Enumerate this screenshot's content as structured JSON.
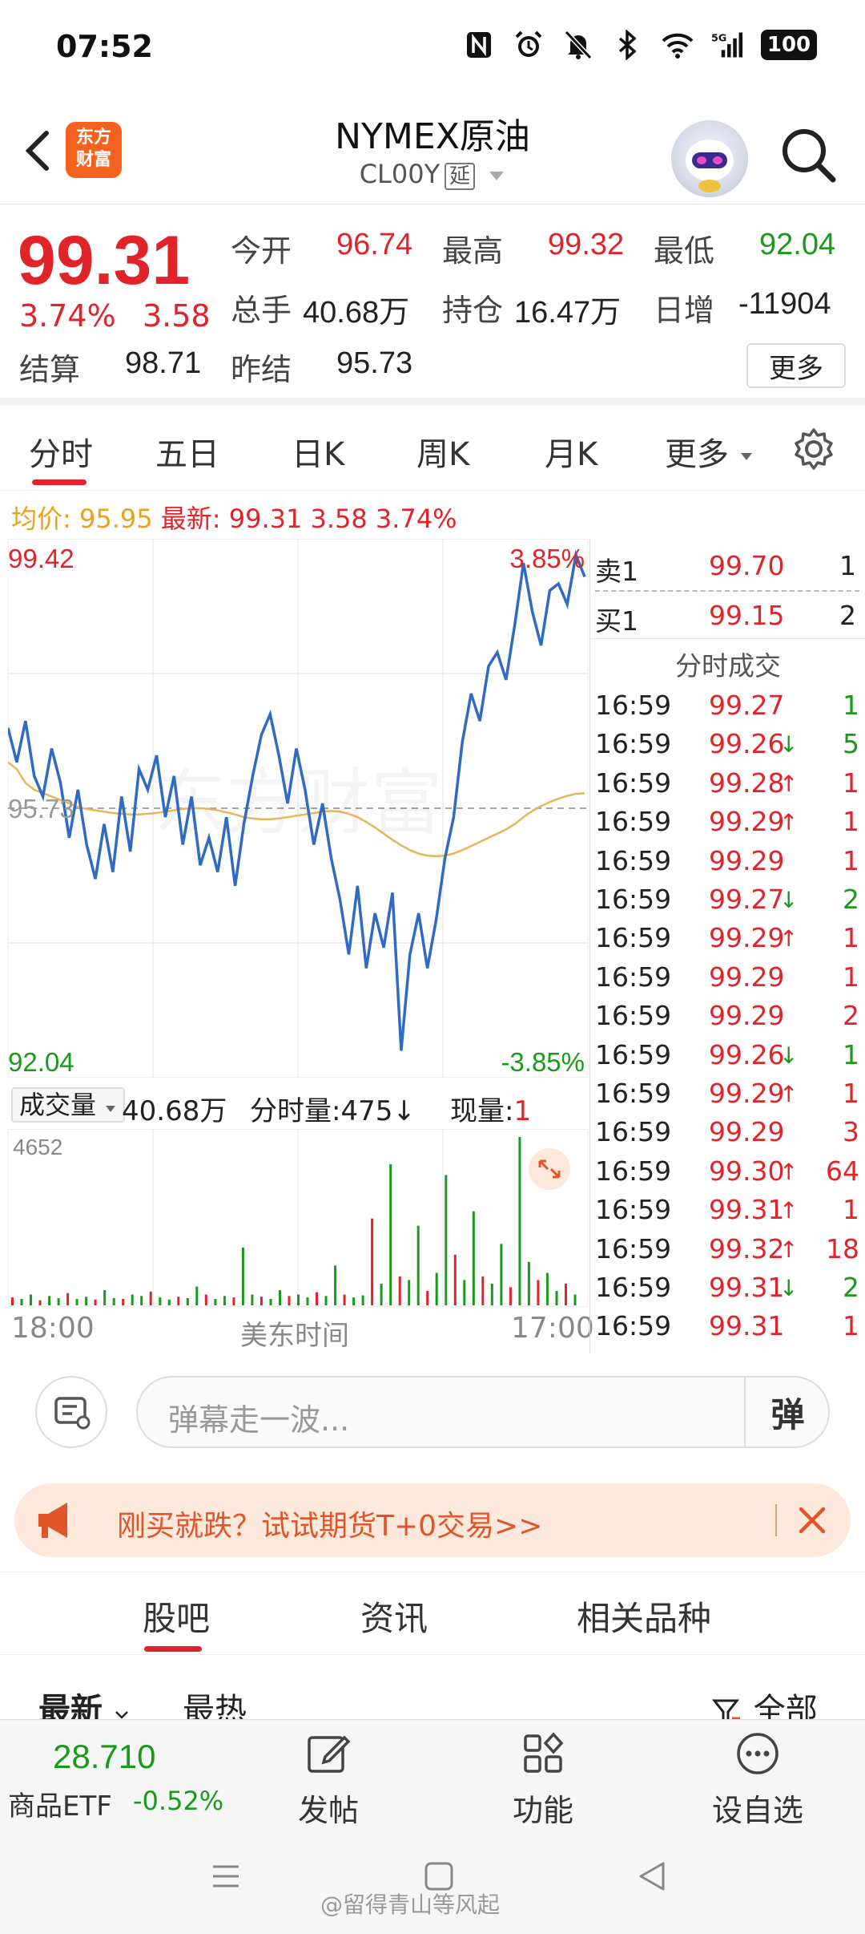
{
  "status_bar": {
    "time": "07:52",
    "battery": "100",
    "icons": [
      "nfc-icon",
      "alarm-icon",
      "mute-icon",
      "bluetooth-icon",
      "wifi-icon",
      "signal-5g-icon",
      "battery-icon"
    ]
  },
  "header": {
    "title": "NYMEX原油",
    "code": "CL00Y",
    "delay_badge": "延",
    "logo_line1": "东方",
    "logo_line2": "财富"
  },
  "quote": {
    "last": "99.31",
    "change_pct": "3.74%",
    "change": "3.58",
    "open_label": "今开",
    "open": "96.74",
    "high_label": "最高",
    "high": "99.32",
    "low_label": "最低",
    "low": "92.04",
    "volume_label": "总手",
    "volume": "40.68万",
    "oi_label": "持仓",
    "oi": "16.47万",
    "daily_inc_label": "日增",
    "daily_inc": "-11904",
    "settle_label": "结算",
    "settle": "98.71",
    "prev_settle_label": "昨结",
    "prev_settle": "95.73",
    "more": "更多"
  },
  "tabs": {
    "items": [
      "分时",
      "五日",
      "日K",
      "周K",
      "月K",
      "更多"
    ],
    "active": 0
  },
  "avg_info": {
    "avg_label": "均价:",
    "avg": "95.95",
    "latest_label": "最新:",
    "latest": "99.31",
    "change": "3.58",
    "change_pct": "3.74%"
  },
  "chart_data": {
    "type": "line",
    "series": [
      {
        "values": [
          96.9,
          96.4,
          97.0,
          96.2,
          95.9,
          96.6,
          96.1,
          95.3,
          96.0,
          95.2,
          94.7,
          95.5,
          94.8,
          95.9,
          95.1,
          96.3,
          96.0,
          96.5,
          95.6,
          96.2,
          95.2,
          95.9,
          94.9,
          95.3,
          94.8,
          95.6,
          94.6,
          95.5,
          96.2,
          96.8,
          97.1,
          96.5,
          95.8,
          96.6,
          96.0,
          95.2,
          95.8,
          95.0,
          94.4,
          93.6,
          94.6,
          93.4,
          94.2,
          93.7,
          94.5,
          92.2,
          93.6,
          94.2,
          93.4,
          94.1,
          95.0,
          95.6,
          96.7,
          97.4,
          97.0,
          97.8,
          98.0,
          97.6,
          98.4,
          99.3,
          98.6,
          98.1,
          98.9,
          99.0,
          98.7,
          99.42,
          99.1
        ]
      },
      {
        "values": [
          96.4,
          96.3,
          96.1,
          96.0,
          95.95,
          95.9,
          95.85,
          95.8,
          95.75,
          95.72,
          95.7,
          95.68,
          95.66,
          95.65,
          95.64,
          95.64,
          95.65,
          95.66,
          95.68,
          95.7,
          95.72,
          95.73,
          95.73,
          95.72,
          95.7,
          95.67,
          95.64,
          95.6,
          95.58,
          95.57,
          95.57,
          95.58,
          95.6,
          95.62,
          95.64,
          95.66,
          95.68,
          95.69,
          95.68,
          95.65,
          95.6,
          95.53,
          95.45,
          95.36,
          95.27,
          95.19,
          95.12,
          95.07,
          95.04,
          95.03,
          95.04,
          95.07,
          95.12,
          95.18,
          95.24,
          95.3,
          95.36,
          95.42,
          95.5,
          95.6,
          95.69,
          95.76,
          95.82,
          95.87,
          95.91,
          95.94,
          95.95
        ]
      }
    ],
    "ylim": [
      92.04,
      99.42
    ],
    "y_ticks_left": [
      "99.42",
      "95.73",
      "92.04"
    ],
    "y_ticks_right": [
      "3.85%",
      "-3.85%"
    ],
    "ref_price": 95.73,
    "x_start": "18:00",
    "x_mid": "美东时间",
    "x_end": "17:00",
    "grid": true
  },
  "volume": {
    "label": "成交量",
    "total": "40.68万",
    "tick_label": "分时量:475↓",
    "current_label": "现量:",
    "current": "1",
    "max_tick": "4652",
    "bars": [
      220,
      180,
      300,
      140,
      260,
      200,
      340,
      180,
      240,
      160,
      420,
      200,
      180,
      300,
      260,
      380,
      220,
      160,
      240,
      200,
      520,
      300,
      180,
      260,
      220,
      1600,
      300,
      240,
      180,
      420,
      260,
      300,
      220,
      360,
      260,
      1100,
      300,
      220,
      280,
      2400,
      600,
      3900,
      800,
      700,
      2200,
      400,
      900,
      3600,
      1400,
      700,
      2600,
      800,
      600,
      1700,
      500,
      4652,
      1200,
      700,
      900,
      400,
      600,
      300
    ]
  },
  "order_book": {
    "ask_label": "卖1",
    "ask_price": "99.70",
    "ask_vol": "1",
    "bid_label": "买1",
    "bid_price": "99.15",
    "bid_vol": "2",
    "trades_title": "分时成交",
    "trades": [
      {
        "time": "16:59",
        "price": "99.27",
        "arrow": "",
        "vol": "1",
        "vol_color": "green"
      },
      {
        "time": "16:59",
        "price": "99.26",
        "arrow": "↓",
        "vol": "5",
        "vol_color": "green"
      },
      {
        "time": "16:59",
        "price": "99.28",
        "arrow": "↑",
        "vol": "1",
        "vol_color": "red"
      },
      {
        "time": "16:59",
        "price": "99.29",
        "arrow": "↑",
        "vol": "1",
        "vol_color": "red"
      },
      {
        "time": "16:59",
        "price": "99.29",
        "arrow": "",
        "vol": "1",
        "vol_color": "red"
      },
      {
        "time": "16:59",
        "price": "99.27",
        "arrow": "↓",
        "vol": "2",
        "vol_color": "green"
      },
      {
        "time": "16:59",
        "price": "99.29",
        "arrow": "↑",
        "vol": "1",
        "vol_color": "red"
      },
      {
        "time": "16:59",
        "price": "99.29",
        "arrow": "",
        "vol": "1",
        "vol_color": "red"
      },
      {
        "time": "16:59",
        "price": "99.29",
        "arrow": "",
        "vol": "2",
        "vol_color": "red"
      },
      {
        "time": "16:59",
        "price": "99.26",
        "arrow": "↓",
        "vol": "1",
        "vol_color": "green"
      },
      {
        "time": "16:59",
        "price": "99.29",
        "arrow": "↑",
        "vol": "1",
        "vol_color": "red"
      },
      {
        "time": "16:59",
        "price": "99.29",
        "arrow": "",
        "vol": "3",
        "vol_color": "red"
      },
      {
        "time": "16:59",
        "price": "99.30",
        "arrow": "↑",
        "vol": "64",
        "vol_color": "red"
      },
      {
        "time": "16:59",
        "price": "99.31",
        "arrow": "↑",
        "vol": "1",
        "vol_color": "red"
      },
      {
        "time": "16:59",
        "price": "99.32",
        "arrow": "↑",
        "vol": "18",
        "vol_color": "red"
      },
      {
        "time": "16:59",
        "price": "99.31",
        "arrow": "↓",
        "vol": "2",
        "vol_color": "green"
      },
      {
        "time": "16:59",
        "price": "99.31",
        "arrow": "",
        "vol": "1",
        "vol_color": "red"
      }
    ]
  },
  "danmaku": {
    "placeholder": "弹幕走一波...",
    "send": "弹"
  },
  "banner": {
    "text": "刚买就跌？试试期货T+0交易>>"
  },
  "bottom_tabs": {
    "items": [
      "股吧",
      "资讯",
      "相关品种"
    ]
  },
  "sort": {
    "latest": "最新",
    "hot": "最热",
    "filter": "全部"
  },
  "bottom_bar": {
    "etf_price": "28.710",
    "etf_name": "商品ETF",
    "etf_change": "-0.52%",
    "post": "发帖",
    "features": "功能",
    "add_watch": "设自选"
  },
  "watermark": "@留得青山等风起"
}
